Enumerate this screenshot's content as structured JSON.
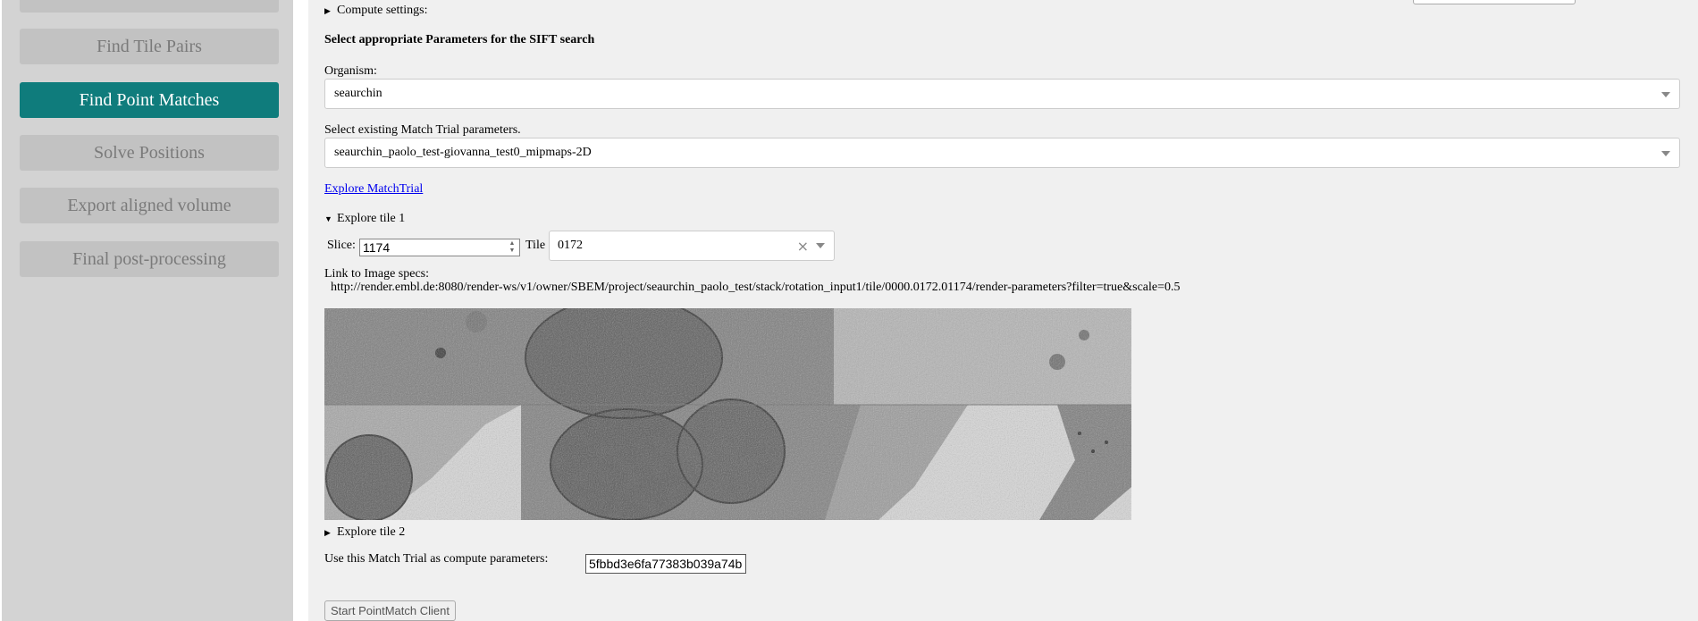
{
  "sidebar": {
    "items": [
      {
        "label": "",
        "active": false
      },
      {
        "label": "Find Tile Pairs",
        "active": false
      },
      {
        "label": "Find Point Matches",
        "active": true
      },
      {
        "label": "Solve Positions",
        "active": false
      },
      {
        "label": "Export aligned volume",
        "active": false
      },
      {
        "label": "Final post-processing",
        "active": false
      }
    ]
  },
  "main": {
    "compute_settings_label": "Compute settings:",
    "sift_heading": "Select appropriate Parameters for the SIFT search",
    "organism_label": "Organism:",
    "organism_value": "seaurchin",
    "match_trial_label": "Select existing Match Trial parameters.",
    "match_trial_value": "seaurchin_paolo_test-giovanna_test0_mipmaps-2D",
    "explore_matchtrial_link": "Explore MatchTrial",
    "explore_tile1_label": "Explore tile 1",
    "slice_label": "Slice:",
    "slice_value": "1174",
    "tile_label": "Tile",
    "tile_value": "0172",
    "image_specs_label": "Link to Image specs:",
    "image_specs_url": "http://render.embl.de:8080/render-ws/v1/owner/SBEM/project/seaurchin_paolo_test/stack/rotation_input1/tile/0000.0172.01174/render-parameters?filter=true&scale=0.5",
    "explore_tile2_label": "Explore tile 2",
    "use_trial_label": "Use this Match Trial as compute parameters:",
    "use_trial_value": "5fbbd3e6fa77383b039a74b",
    "start_button_label": "Start PointMatch Client"
  },
  "colors": {
    "sidebar_bg": "#d3d3d3",
    "button_bg": "#c2c2c2",
    "active_button_bg": "#0f7c7c",
    "main_bg": "#f0f0f0",
    "link": "#0000ee"
  }
}
